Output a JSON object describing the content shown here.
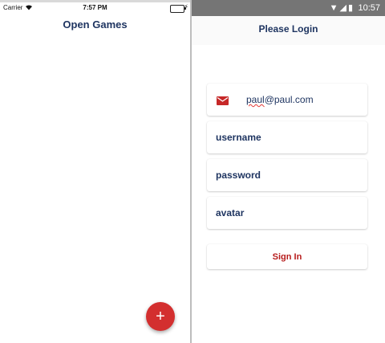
{
  "ios": {
    "status": {
      "carrier": "Carrier",
      "time": "7:57 PM"
    },
    "title": "Open Games",
    "fab_label": "+"
  },
  "android": {
    "status": {
      "time": "10:57"
    },
    "title": "Please Login",
    "fields": {
      "email_spell": "paul",
      "email_rest": "@paul.com",
      "username": "username",
      "password": "password",
      "avatar": "avatar"
    },
    "signin_label": "Sign In"
  },
  "colors": {
    "accent": "#d32f2f",
    "title": "#1f3561",
    "signin": "#b71c1c"
  },
  "icons": [
    "wifi-icon",
    "battery-icon",
    "mail-icon",
    "signal-icon",
    "plus-icon"
  ]
}
